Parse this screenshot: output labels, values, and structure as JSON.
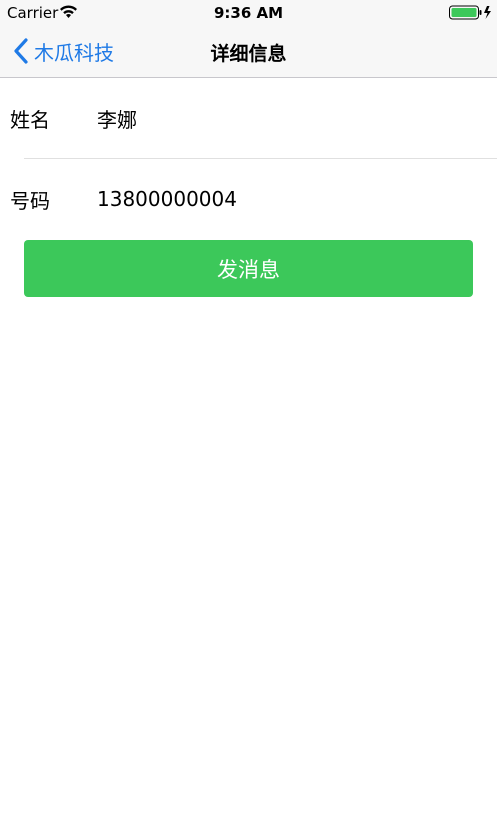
{
  "status_bar": {
    "carrier": "Carrier",
    "time": "9:36 AM",
    "wifi_icon": "wifi-icon",
    "battery_icon": "battery-icon",
    "battery_color": "#3cc85a"
  },
  "nav": {
    "back_label": "木瓜科技",
    "title": "详细信息",
    "accent_color": "#1f7ae6"
  },
  "detail": {
    "name_label": "姓名",
    "name_value": "李娜",
    "phone_label": "号码",
    "phone_value": "13800000004"
  },
  "actions": {
    "send_label": "发消息",
    "send_color": "#3cc85a"
  }
}
